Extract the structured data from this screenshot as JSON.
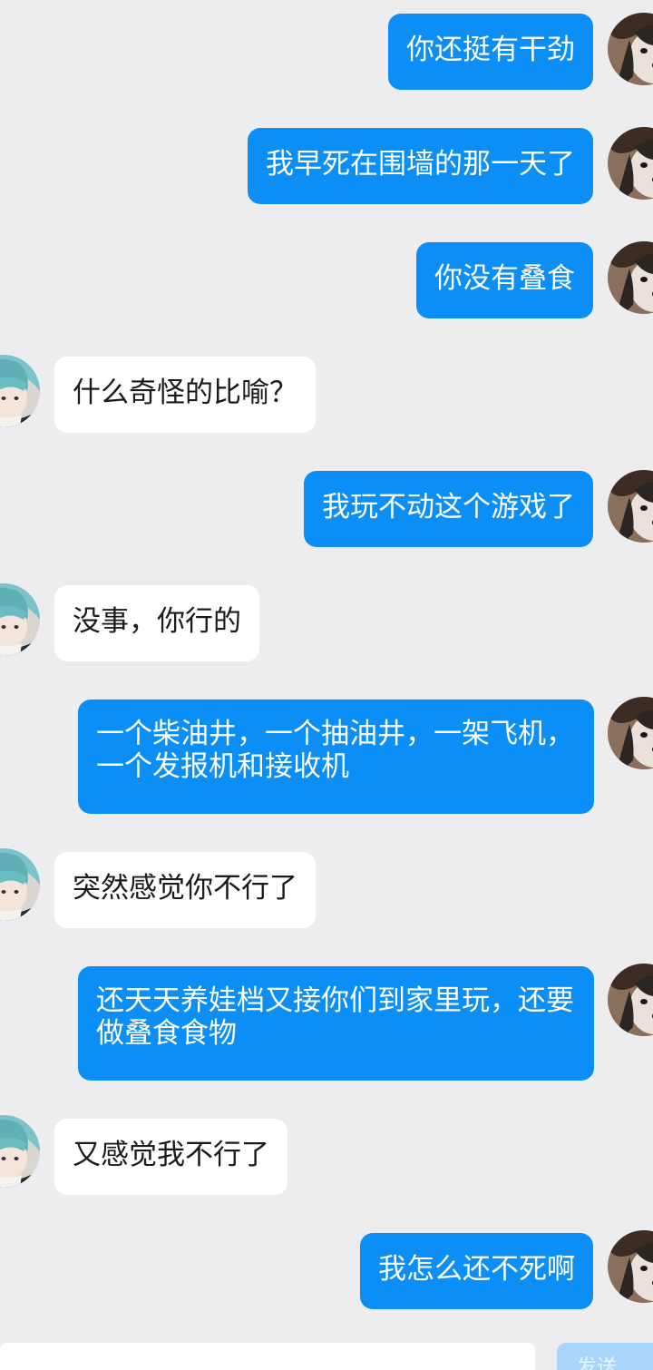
{
  "messages": [
    {
      "side": "sent",
      "text": "你还挺有干劲"
    },
    {
      "side": "sent",
      "text": "我早死在围墙的那一天了"
    },
    {
      "side": "sent",
      "text": "你没有叠食"
    },
    {
      "side": "received",
      "text": "什么奇怪的比喻？"
    },
    {
      "side": "sent",
      "text": "我玩不动这个游戏了"
    },
    {
      "side": "received",
      "text": "没事，你行的"
    },
    {
      "side": "sent",
      "text": "一个柴油井，一个抽油井，一架飞机，一个发报机和接收机"
    },
    {
      "side": "received",
      "text": "突然感觉你不行了"
    },
    {
      "side": "sent",
      "text": "还天天养娃档又接你们到家里玩，还要做叠食食物"
    },
    {
      "side": "received",
      "text": "又感觉我不行了"
    },
    {
      "side": "sent",
      "text": "我怎么还不死啊"
    }
  ],
  "composer": {
    "send_label": "发送"
  },
  "colors": {
    "background": "#ededf0",
    "sent_bubble": "#0b8ef5",
    "received_bubble": "#ffffff",
    "send_button": "#a9d4fb"
  },
  "avatars": {
    "self": "husky-dog-avatar",
    "other": "anime-girl-avatar"
  }
}
